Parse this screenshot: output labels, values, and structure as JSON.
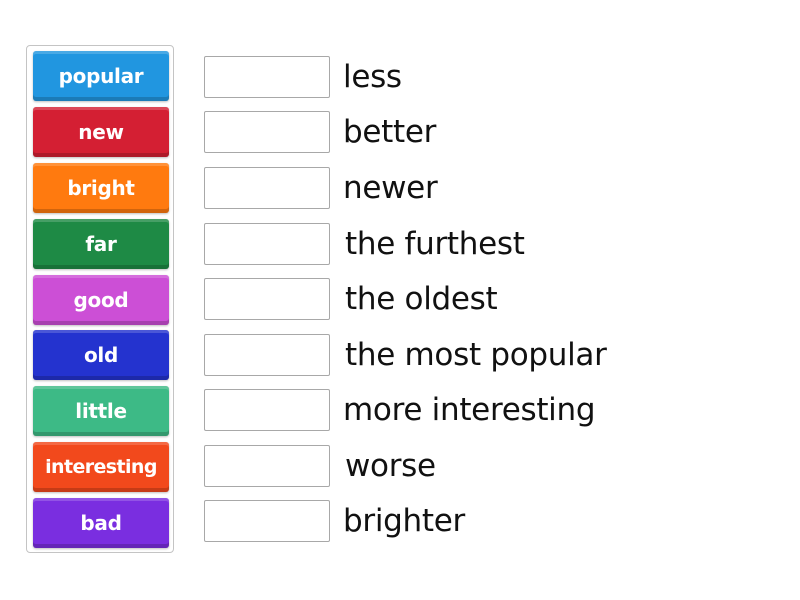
{
  "activity": {
    "type": "match-up",
    "tiles": [
      {
        "label": "popular",
        "color": "#2196e0"
      },
      {
        "label": "new",
        "color": "#d41f33"
      },
      {
        "label": "bright",
        "color": "#ff7a0f"
      },
      {
        "label": "far",
        "color": "#1e8a45"
      },
      {
        "label": "good",
        "color": "#cc4fd6"
      },
      {
        "label": "old",
        "color": "#2433cf"
      },
      {
        "label": "little",
        "color": "#3dba86"
      },
      {
        "label": "interesting",
        "color": "#f2491c"
      },
      {
        "label": "bad",
        "color": "#7a2ee0"
      }
    ],
    "targets": [
      {
        "answer": "",
        "clue": "less"
      },
      {
        "answer": "",
        "clue": "better"
      },
      {
        "answer": "",
        "clue": "newer"
      },
      {
        "answer": "",
        "clue": "the furthest"
      },
      {
        "answer": "",
        "clue": "the oldest"
      },
      {
        "answer": "",
        "clue": "the most popular"
      },
      {
        "answer": "",
        "clue": "more interesting"
      },
      {
        "answer": "",
        "clue": "worse"
      },
      {
        "answer": "",
        "clue": "brighter"
      }
    ]
  }
}
